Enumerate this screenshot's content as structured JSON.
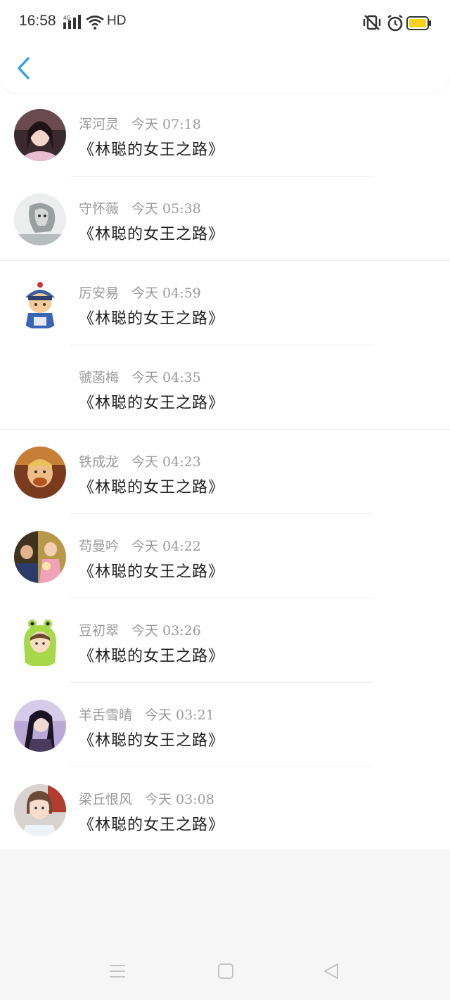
{
  "status_bar": {
    "time": "16:58",
    "network_label": "4G",
    "hd_label": "HD",
    "battery_color": "#f6d21b"
  },
  "header": {
    "back_icon": "chevron-left-icon",
    "accent_color": "#2a9df4"
  },
  "list": {
    "items": [
      {
        "name": "浑河灵",
        "time": "今天 07:18",
        "title": "《林聪的女王之路》",
        "avatar": "photo-woman"
      },
      {
        "name": "守怀薇",
        "time": "今天 05:38",
        "title": "《林聪的女王之路》",
        "avatar": "lion-sketch"
      },
      {
        "name": "厉安易",
        "time": "今天 04:59",
        "title": "《林聪的女王之路》",
        "avatar": "cartoon-official"
      },
      {
        "name": "虢菡梅",
        "time": "今天 04:35",
        "title": "《林聪的女王之路》",
        "avatar": "none"
      },
      {
        "name": "铁成龙",
        "time": "今天 04:23",
        "title": "《林聪的女王之路》",
        "avatar": "photo-child"
      },
      {
        "name": "苟曼吟",
        "time": "今天 04:22",
        "title": "《林聪的女王之路》",
        "avatar": "photo-couple"
      },
      {
        "name": "豆初翠",
        "time": "今天 03:26",
        "title": "《林聪的女王之路》",
        "avatar": "cartoon-frog-hat"
      },
      {
        "name": "羊舌雪晴",
        "time": "今天 03:21",
        "title": "《林聪的女王之路》",
        "avatar": "photo-woman-purple"
      },
      {
        "name": "梁丘恨风",
        "time": "今天 03:08",
        "title": "《林聪的女王之路》",
        "avatar": "photo-woman-bob"
      }
    ]
  },
  "nav_bar": {
    "menu_icon": "menu-icon",
    "home_icon": "home-icon",
    "back_icon": "back-triangle-icon"
  }
}
